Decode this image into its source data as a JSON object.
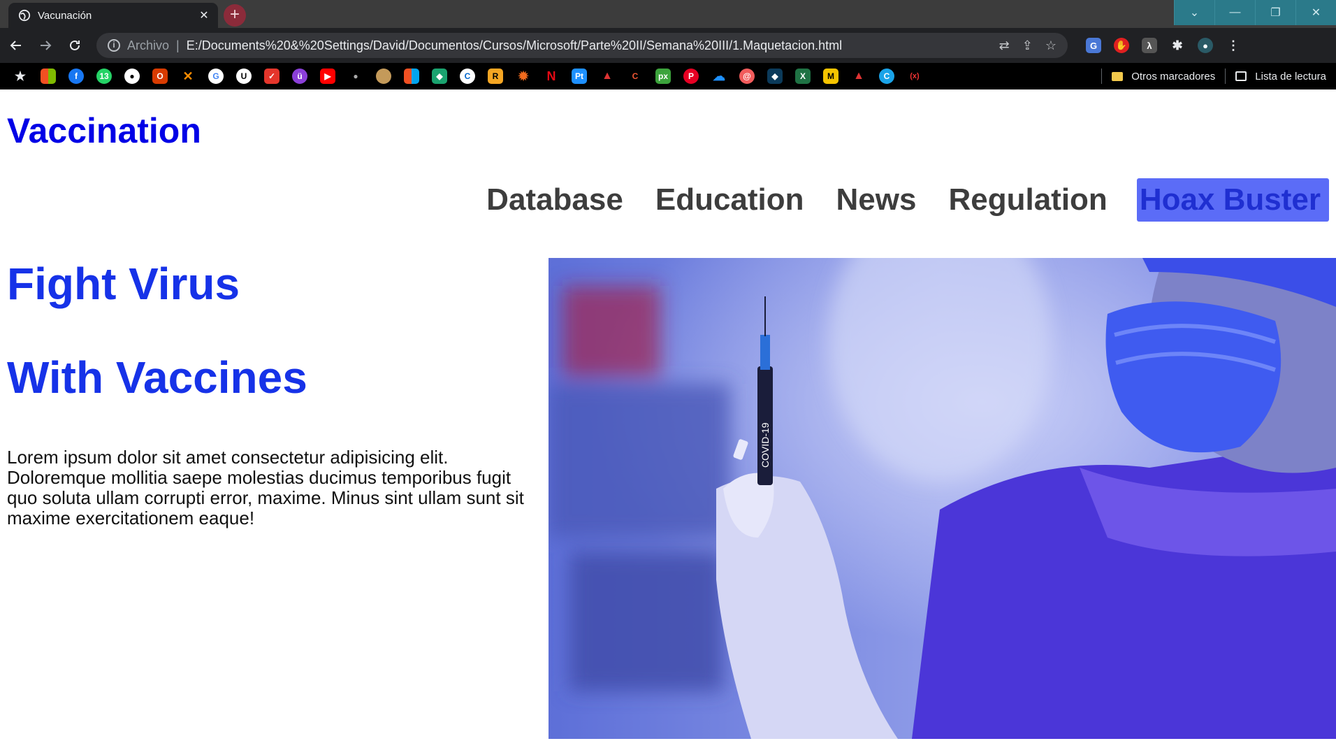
{
  "browser": {
    "tab_title": "Vacunación",
    "tab_close": "✕",
    "new_tab": "+",
    "address_scheme": "Archivo",
    "address_separator": "|",
    "address_url": "E:/Documents%20&%20Settings/David/Documentos/Cursos/Microsoft/Parte%20II/Semana%20III/1.Maquetacion.html",
    "bookmarks_folder": "Otros marcadores",
    "reading_list": "Lista de lectura",
    "window_controls": [
      "⌄",
      "—",
      "❐",
      "✕"
    ]
  },
  "page": {
    "brand": "Vaccination",
    "nav": [
      {
        "label": "Database"
      },
      {
        "label": "Education"
      },
      {
        "label": "News"
      },
      {
        "label": "Regulation"
      },
      {
        "label": "Hoax Buster",
        "active": true
      }
    ],
    "hero_title_line1": "Fight Virus",
    "hero_title_line2": "With Vaccines",
    "hero_text": "Lorem ipsum dolor sit amet consectetur adipisicing elit. Doloremque mollitia saepe molestias ducimus temporibus fugit quo soluta ullam corrupti error, maxime. Minus sint ullam sunt sit maxime exercitationem eaque!",
    "syringe_label": "COVID-19"
  },
  "colors": {
    "brand": "#0000e6",
    "hero_title": "#1632e8",
    "nav_active_bg": "#5b6cf7",
    "nav_text": "#3d3d3d"
  }
}
